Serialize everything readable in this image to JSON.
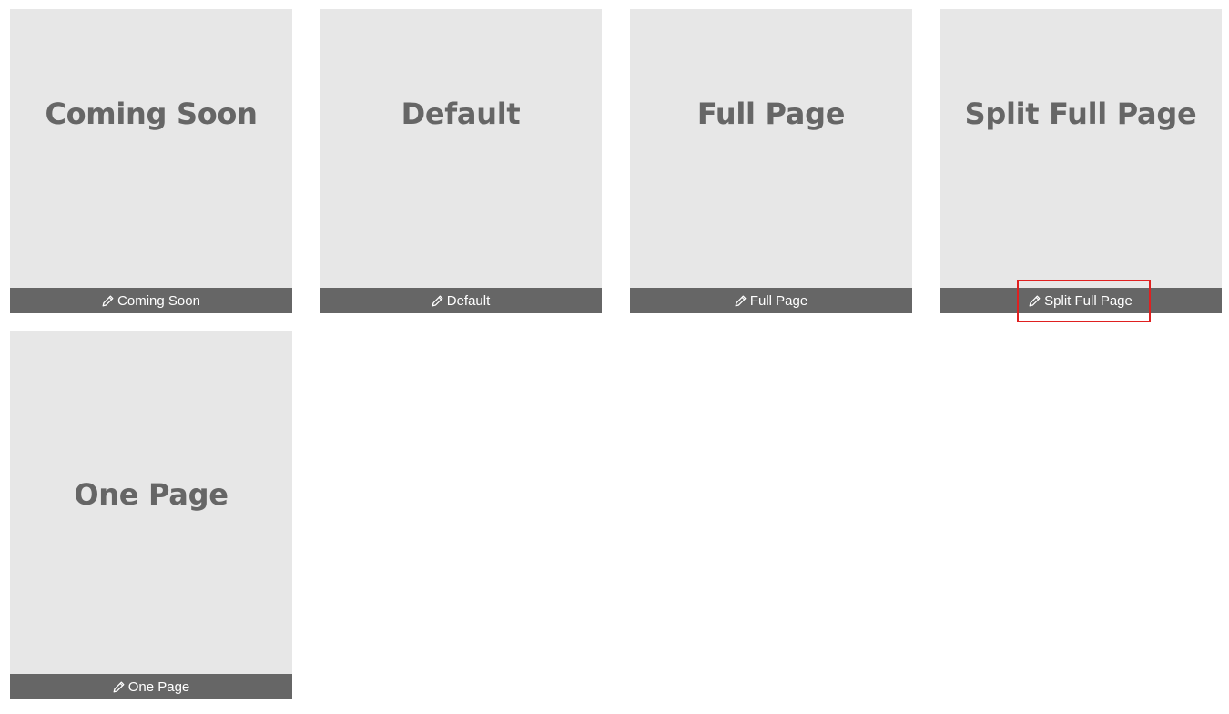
{
  "cards": [
    {
      "title": "Coming Soon",
      "edit_label": "Coming Soon"
    },
    {
      "title": "Default",
      "edit_label": "Default"
    },
    {
      "title": "Full Page",
      "edit_label": "Full Page"
    },
    {
      "title": "Split Full Page",
      "edit_label": "Split Full Page"
    },
    {
      "title": "One Page",
      "edit_label": "One Page"
    }
  ],
  "icons": {
    "edit": "pencil-icon"
  },
  "colors": {
    "card_bg": "#e7e7e7",
    "bar_bg": "#666666",
    "title_text": "#666666",
    "bar_text": "#ffffff",
    "highlight": "#e02020"
  }
}
